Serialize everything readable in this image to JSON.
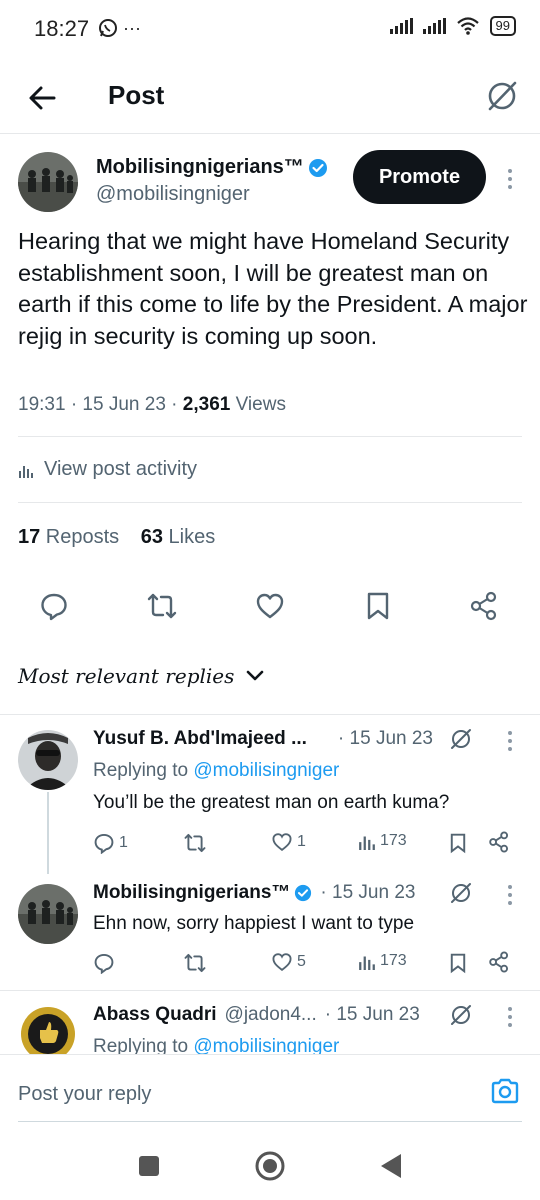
{
  "status_bar": {
    "time": "18:27",
    "extra": "···",
    "battery": "99"
  },
  "header": {
    "title": "Post"
  },
  "post": {
    "author_name": "Mobilisingnigerians™",
    "handle": "@mobilisingniger",
    "promote_label": "Promote",
    "text": "Hearing that we might have Homeland Security establishment soon, I will be greatest man on earth if this come to life by the President. A major rejig in security is coming up soon.",
    "time": "19:31 · 15 Jun 23 · ",
    "views_count": "2,361",
    "views_label": " Views",
    "activity_label": "View post activity",
    "reposts_count": "17",
    "reposts_label": " Reposts",
    "likes_count": "63",
    "likes_label": " Likes"
  },
  "replies_sort": "Most relevant replies",
  "replies": [
    {
      "name": "Yusuf B. Abd'lmajeed ...",
      "date": "· 15 Jun 23",
      "replying_prefix": "Replying to ",
      "replying_to": "@mobilisingniger",
      "text": "You’ll be the greatest man on earth kuma?",
      "replies": "1",
      "reposts": "",
      "likes": "1",
      "views": "173"
    },
    {
      "name": "Mobilisingnigerians™",
      "date": "· 15 Jun 23",
      "text": "Ehn now, sorry happiest I want to type",
      "replies": "",
      "reposts": "",
      "likes": "5",
      "views": "173"
    },
    {
      "name": "Abass Quadri",
      "handle": "@jadon4...",
      "date": "· 15 Jun 23",
      "replying_prefix": "Replying to ",
      "replying_to": "@mobilisingniger"
    }
  ],
  "compose": {
    "placeholder": "Post your reply"
  },
  "colors": {
    "accent": "#1d9bf0",
    "text": "#0f1419",
    "muted": "#536471",
    "divider": "#e6e8ea"
  }
}
